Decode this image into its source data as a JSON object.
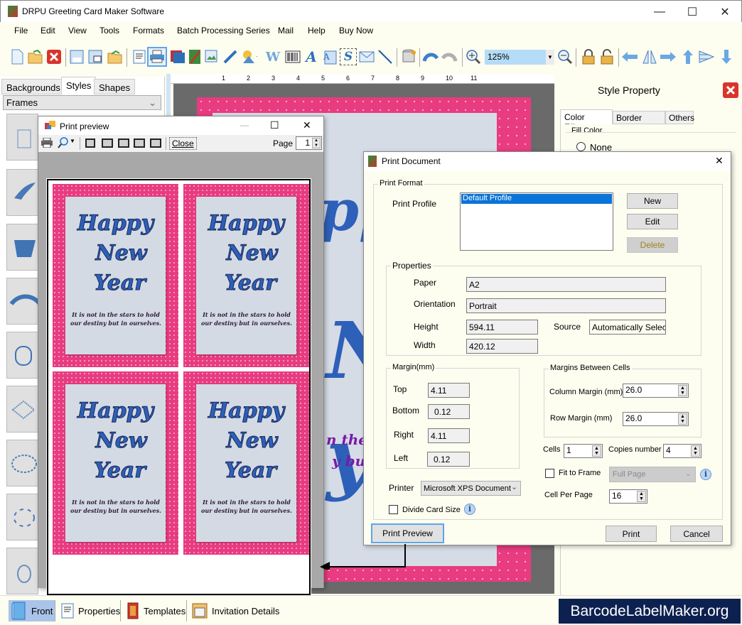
{
  "window": {
    "title": "DRPU Greeting Card Maker Software",
    "minimize": "—",
    "maximize": "☐",
    "close": "✕"
  },
  "menu": [
    "File",
    "Edit",
    "View",
    "Tools",
    "Formats",
    "Batch Processing Series",
    "Mail",
    "Help",
    "Buy Now"
  ],
  "toolbar": {
    "zoom_value": "125%",
    "icons": [
      "new-icon",
      "open-icon",
      "close-doc-icon",
      "save-icon",
      "save-as-icon",
      "export-icon",
      "properties-icon",
      "print-icon",
      "background-icon",
      "image-edit-icon",
      "insert-image-icon",
      "pen-icon",
      "shapes-icon",
      "word-art-icon",
      "barcode-icon",
      "text-icon",
      "text-box-icon",
      "signature-icon",
      "mail-icon",
      "line-icon",
      "database-icon",
      "undo-icon",
      "redo-icon",
      "zoom-in-icon",
      "zoom-out-icon",
      "lock-icon",
      "unlock-icon",
      "arrow-left-icon",
      "flip-icon",
      "arrow-right-icon",
      "arrow-up-icon",
      "align-icon",
      "arrow-down-icon"
    ]
  },
  "left_panel": {
    "tabs": [
      "Backgrounds",
      "Styles",
      "Shapes"
    ],
    "active_tab": "Styles",
    "category": "Frames"
  },
  "ruler": {
    "marks": [
      "1",
      "2",
      "3",
      "4",
      "5",
      "6",
      "7",
      "8",
      "9",
      "10",
      "11"
    ]
  },
  "canvas": {
    "visible_text_1": "n the",
    "visible_text_2": "y but"
  },
  "style_property": {
    "title": "Style Property",
    "tabs": [
      "Color Effects",
      "Border Effect",
      "Others"
    ],
    "fill_color_label": "Fill Color",
    "fill_option": "None"
  },
  "print_preview": {
    "title": "Print preview",
    "close_label": "Close",
    "page_label": "Page",
    "page_value": "1",
    "card": {
      "line1": "Happy",
      "line2": "New",
      "line3": "Year",
      "quote_1": "It is not in the stars to  hold",
      "quote_2": "our destiny but  in ourselves."
    }
  },
  "print_document": {
    "title": "Print Document",
    "print_format_label": "Print Format",
    "print_profile_label": "Print Profile",
    "profiles": [
      "Default Profile"
    ],
    "selected_profile": "Default Profile",
    "buttons": {
      "new": "New",
      "edit": "Edit",
      "delete": "Delete",
      "print_preview": "Print Preview",
      "print": "Print",
      "cancel": "Cancel"
    },
    "properties": {
      "label": "Properties",
      "paper_label": "Paper",
      "paper": "A2",
      "orientation_label": "Orientation",
      "orientation": "Portrait",
      "height_label": "Height",
      "height": "594.11",
      "width_label": "Width",
      "width": "420.12",
      "source_label": "Source",
      "source": "Automatically Select"
    },
    "margin": {
      "label": "Margin(mm)",
      "top_label": "Top",
      "top": "4.11",
      "bottom_label": "Bottom",
      "bottom": "0.12",
      "right_label": "Right",
      "right": "4.11",
      "left_label": "Left",
      "left": "0.12"
    },
    "cell_margins": {
      "label": "Margins Between Cells",
      "column_label": "Column Margin (mm)",
      "column": "26.0",
      "row_label": "Row Margin (mm)",
      "row": "26.0"
    },
    "cells_label": "Cells",
    "cells": "1",
    "copies_label": "Copies number",
    "copies": "4",
    "fit_to_frame_label": "Fit to Frame",
    "fit_to_frame_checked": false,
    "fit_mode": "Full Page",
    "cell_per_page_label": "Cell Per Page",
    "cell_per_page": "16",
    "printer_label": "Printer",
    "printer": "Microsoft XPS Document Writer",
    "divide_card_label": "Divide Card Size",
    "divide_card_checked": false
  },
  "bottom_tabs": [
    "Front",
    "Properties",
    "Templates",
    "Invitation Details"
  ],
  "active_bottom_tab": "Front",
  "brand": "BarcodeLabelMaker.org"
}
